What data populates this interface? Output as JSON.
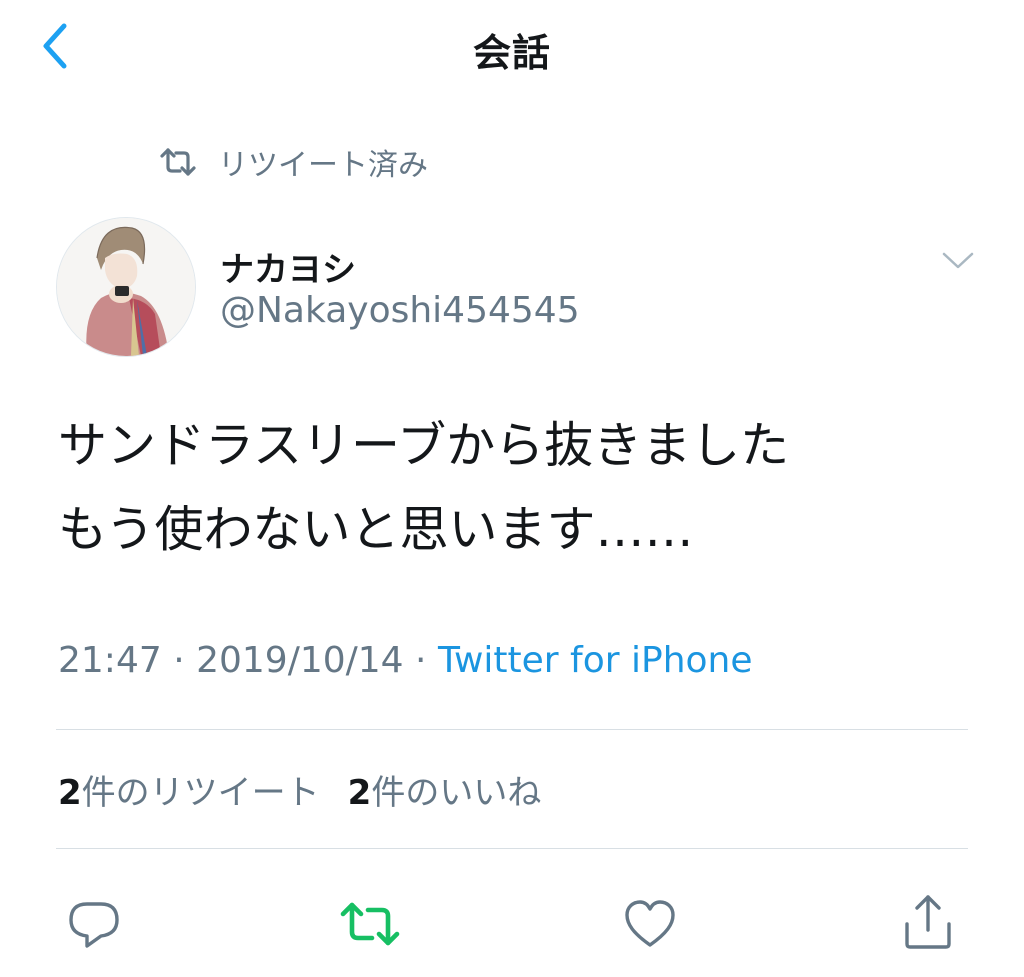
{
  "header": {
    "title": "会話"
  },
  "retweet_context": {
    "label": "リツイート済み"
  },
  "tweet": {
    "display_name": "ナカヨシ",
    "handle": "@Nakayoshi454545",
    "text_lines": [
      "サンドラスリーブから抜きました",
      "もう使わないと思います……"
    ],
    "time": "21:47",
    "separator": " · ",
    "date": "2019/10/14",
    "source": "Twitter for iPhone"
  },
  "stats": {
    "retweets_count": "2",
    "retweets_label": "件のリツイート",
    "likes_count": "2",
    "likes_label": "件のいいね"
  },
  "colors": {
    "accent": "#1da1f2",
    "link": "#1b95e0",
    "secondary_text": "#657786",
    "retweet_active": "#17bf63",
    "divider": "#d8dfe4"
  },
  "icons": {
    "back": "chevron-left-icon",
    "retweet_context": "retweet-icon",
    "menu": "chevron-down-icon",
    "reply": "reply-icon",
    "retweet": "retweet-icon",
    "like": "heart-icon",
    "share": "share-icon"
  }
}
